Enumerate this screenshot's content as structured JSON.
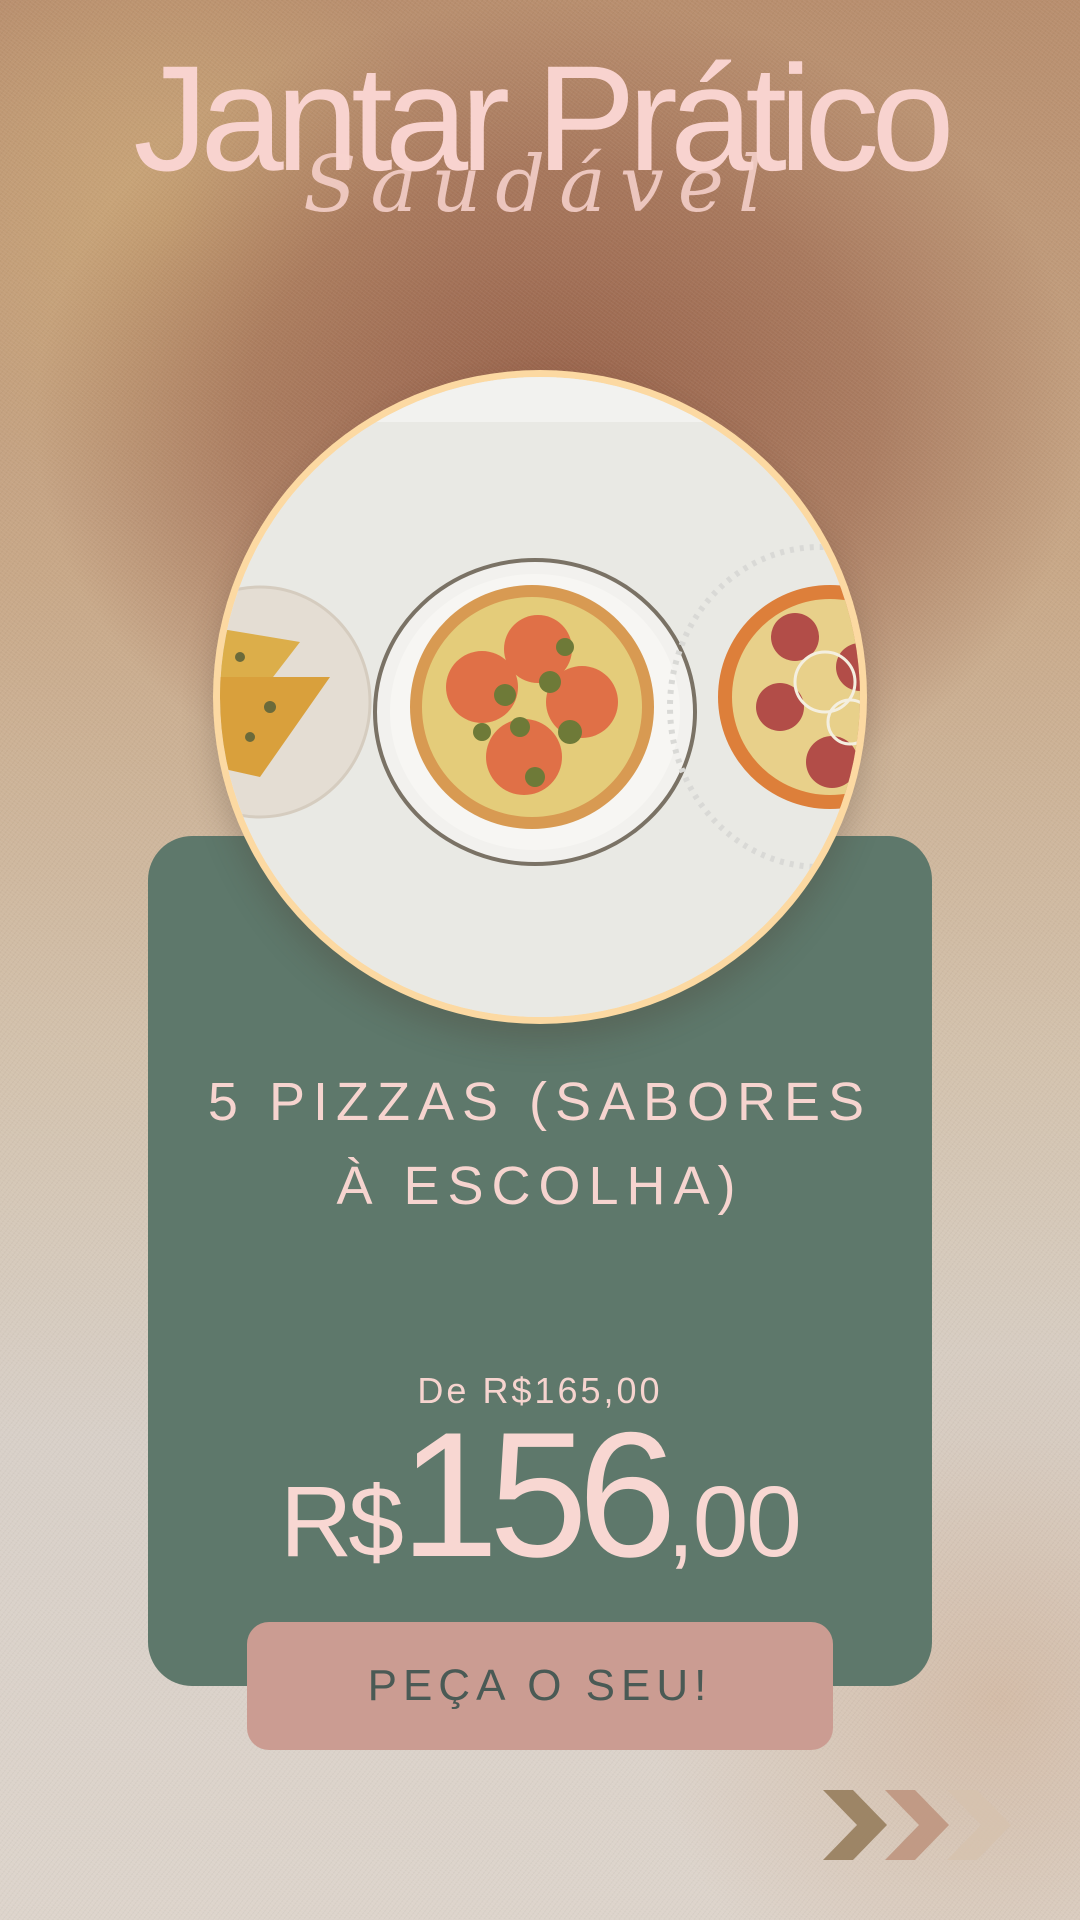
{
  "header": {
    "title": "Jantar Prático",
    "subtitle": "Saudável"
  },
  "product": {
    "image_icon": "pizza-photo",
    "headline_line1": "5 PIZZAS (SABORES",
    "headline_line2": "À ESCOLHA)",
    "old_price": "De R$165,00",
    "price_currency": "R$",
    "price_integer": "156",
    "price_decimal": ",00"
  },
  "cta": {
    "label": "PEÇA O SEU!"
  },
  "navigation": {
    "next_icon": "triple-chevron-right-icon"
  },
  "colors": {
    "title": "#f8d3cf",
    "card": "#5e786b",
    "cta": "#cb9c92",
    "photo_ring": "#fcd9a2"
  }
}
